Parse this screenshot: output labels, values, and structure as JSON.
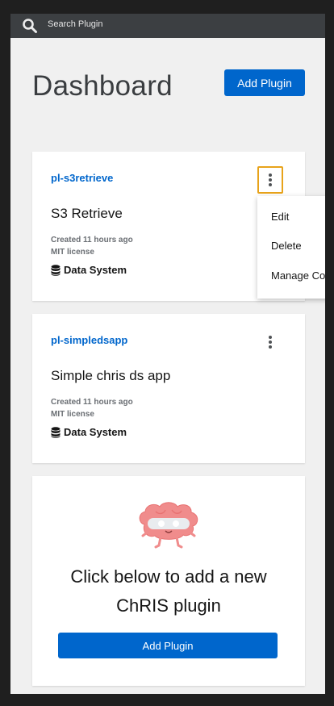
{
  "search": {
    "placeholder": "Search Plugin"
  },
  "header": {
    "title": "Dashboard",
    "add_button": "Add Plugin"
  },
  "plugins": [
    {
      "name": "pl-s3retrieve",
      "title": "S3 Retrieve",
      "created": "Created 11 hours ago",
      "license": "MIT license",
      "category": "Data System",
      "menu_open": true
    },
    {
      "name": "pl-simpledsapp",
      "title": "Simple chris ds app",
      "created": "Created 11 hours ago",
      "license": "MIT license",
      "category": "Data System",
      "menu_open": false
    }
  ],
  "menu": {
    "items": [
      "Edit",
      "Delete",
      "Manage Co"
    ]
  },
  "cta": {
    "line1": "Click below to add a new",
    "line2": "ChRIS plugin",
    "button": "Add Plugin"
  },
  "colors": {
    "primary": "#0066cc",
    "focus": "#e8a31a",
    "topbar": "#3c3f42",
    "mascot": "#f08c8c"
  }
}
